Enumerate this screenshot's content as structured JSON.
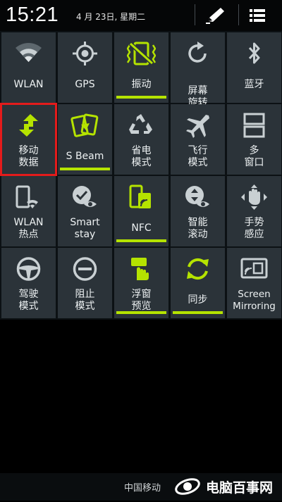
{
  "status_bar": {
    "time": "15:21",
    "date": "4 月 23日, 星期二",
    "edit_icon": "pencil-icon",
    "menu_icon": "list-menu-icon"
  },
  "quick_settings": {
    "accent_color": "#b5e300",
    "tile_color": "#2b3339",
    "tiles": [
      {
        "label": "WLAN",
        "icon": "wifi-icon",
        "active": false
      },
      {
        "label": "GPS",
        "icon": "gps-icon",
        "active": false
      },
      {
        "label": "振动",
        "icon": "vibrate-icon",
        "active": true
      },
      {
        "label": "屏幕\n旋转",
        "icon": "screen-rotate-icon",
        "active": false
      },
      {
        "label": "蓝牙",
        "icon": "bluetooth-icon",
        "active": false
      },
      {
        "label": "移动\n数据",
        "icon": "mobile-data-icon",
        "active": true,
        "selected": true
      },
      {
        "label": "S Beam",
        "icon": "s-beam-icon",
        "active": true
      },
      {
        "label": "省电\n模式",
        "icon": "power-saving-icon",
        "active": false
      },
      {
        "label": "飞行\n模式",
        "icon": "airplane-icon",
        "active": false
      },
      {
        "label": "多\n窗口",
        "icon": "multi-window-icon",
        "active": false
      },
      {
        "label": "WLAN\n热点",
        "icon": "wifi-hotspot-icon",
        "active": false
      },
      {
        "label": "Smart\nstay",
        "icon": "smart-stay-icon",
        "active": false
      },
      {
        "label": "NFC",
        "icon": "nfc-icon",
        "active": true
      },
      {
        "label": "智能\n滚动",
        "icon": "smart-scroll-icon",
        "active": false
      },
      {
        "label": "手势\n感应",
        "icon": "gesture-icon",
        "active": false
      },
      {
        "label": "驾驶\n模式",
        "icon": "driving-mode-icon",
        "active": false
      },
      {
        "label": "阻止\n模式",
        "icon": "blocking-mode-icon",
        "active": false
      },
      {
        "label": "浮窗\n预览",
        "icon": "air-view-icon",
        "active": true
      },
      {
        "label": "同步",
        "icon": "sync-icon",
        "active": true
      },
      {
        "label": "Screen\nMirroring",
        "icon": "screen-mirroring-icon",
        "active": false
      }
    ]
  },
  "bottom_bar": {
    "carrier": "中国移动",
    "watermark_text": "电脑百事网",
    "watermark_logo": "pc841-logo-icon"
  }
}
